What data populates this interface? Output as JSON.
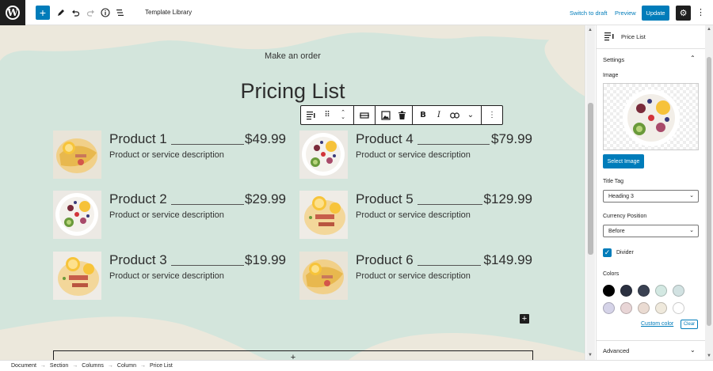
{
  "topbar": {
    "title": "Template Library",
    "switch_to_draft": "Switch to draft",
    "preview": "Preview",
    "update": "Update"
  },
  "canvas": {
    "subtitle": "Make an order",
    "heading": "Pricing List",
    "items": [
      {
        "name": "Product 1",
        "price": "$49.99",
        "description": "Product or service description",
        "image": "crepe-orange"
      },
      {
        "name": "Product 2",
        "price": "$29.99",
        "description": "Product or service description",
        "image": "fruit-bowl"
      },
      {
        "name": "Product 3",
        "price": "$19.99",
        "description": "Product or service description",
        "image": "crepe-bacon"
      },
      {
        "name": "Product 4",
        "price": "$79.99",
        "description": "Product or service description",
        "image": "fruit-bowl"
      },
      {
        "name": "Product 5",
        "price": "$129.99",
        "description": "Product or service description",
        "image": "crepe-bacon"
      },
      {
        "name": "Product 6",
        "price": "$149.99",
        "description": "Product or service description",
        "image": "crepe-orange"
      }
    ],
    "appender": "+"
  },
  "breadcrumb": [
    "Document",
    "Section",
    "Columns",
    "Column",
    "Price List"
  ],
  "breadcrumb_sep": "→",
  "sidebar": {
    "block_name": "Price List",
    "settings_title": "Settings",
    "image_label": "Image",
    "select_image": "Select Image",
    "title_tag_label": "Title Tag",
    "title_tag_value": "Heading 3",
    "currency_label": "Currency Position",
    "currency_value": "Before",
    "divider_label": "Divider",
    "colors_label": "Colors",
    "colors": [
      "#000000",
      "#2b3040",
      "#3a4152",
      "#d3e8e2",
      "#d2e2e2",
      "#d5d3e8",
      "#e8d5d6",
      "#eadbd2",
      "#efe9dc",
      "#ffffff"
    ],
    "custom_color": "Custom color",
    "clear": "Clear",
    "advanced": "Advanced"
  },
  "theme": {
    "accent": "#007cba",
    "canvas_bg": "#d3e5dc",
    "wave": "#ece8dc"
  }
}
